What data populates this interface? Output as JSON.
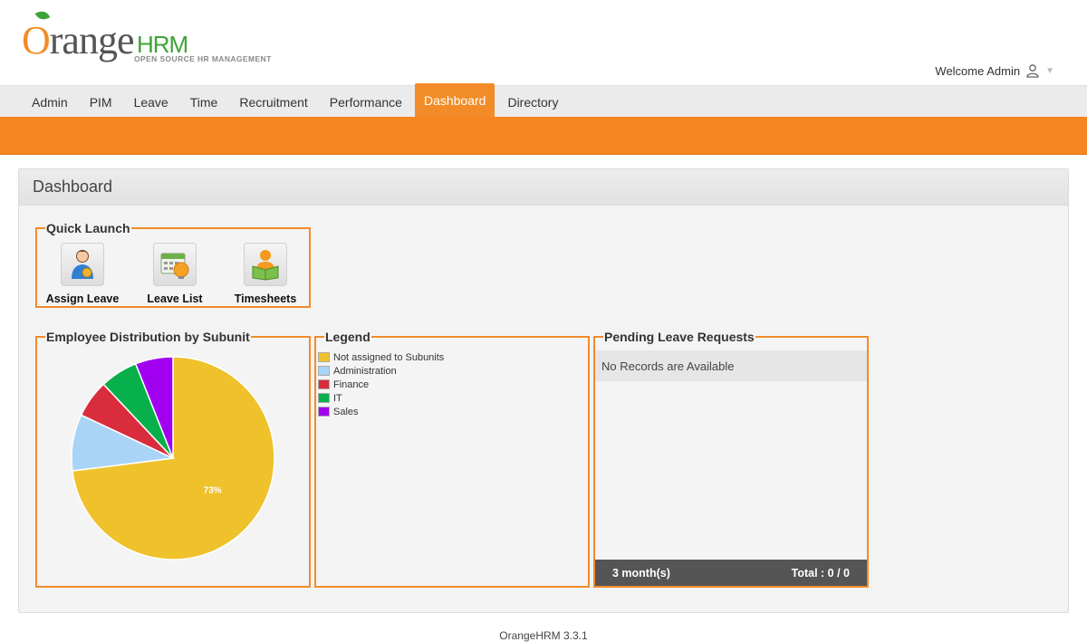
{
  "branding": {
    "logo_main": "range",
    "logo_o": "O",
    "logo_hrm": "HRM",
    "logo_tagline": "OPEN SOURCE HR MANAGEMENT",
    "welcome": "Welcome Admin"
  },
  "menu": {
    "items": [
      {
        "label": "Admin"
      },
      {
        "label": "PIM"
      },
      {
        "label": "Leave"
      },
      {
        "label": "Time"
      },
      {
        "label": "Recruitment"
      },
      {
        "label": "Performance"
      },
      {
        "label": "Dashboard",
        "active": true
      },
      {
        "label": "Directory"
      }
    ]
  },
  "dashboard": {
    "title": "Dashboard",
    "quick_launch": {
      "title": "Quick Launch",
      "items": [
        {
          "label": "Assign Leave",
          "icon": "assign-leave-icon"
        },
        {
          "label": "Leave List",
          "icon": "leave-list-icon"
        },
        {
          "label": "Timesheets",
          "icon": "timesheets-icon"
        }
      ]
    },
    "distribution": {
      "title": "Employee Distribution by Subunit"
    },
    "legend": {
      "title": "Legend",
      "items": [
        {
          "label": "Not assigned to Subunits",
          "color": "#efc22b"
        },
        {
          "label": "Administration",
          "color": "#aad4f5"
        },
        {
          "label": "Finance",
          "color": "#d92d3d"
        },
        {
          "label": "IT",
          "color": "#07b04a"
        },
        {
          "label": "Sales",
          "color": "#a000ef"
        }
      ]
    },
    "pending": {
      "title": "Pending Leave Requests",
      "empty_text": "No Records are Available",
      "period": "3 month(s)",
      "total": "Total : 0 / 0"
    }
  },
  "chart_data": {
    "type": "pie",
    "categories": [
      "Not assigned to Subunits",
      "Administration",
      "Finance",
      "IT",
      "Sales"
    ],
    "values": [
      73,
      9,
      6,
      6,
      6
    ],
    "colors": [
      "#efc22b",
      "#aad4f5",
      "#d92d3d",
      "#07b04a",
      "#a000ef"
    ],
    "data_labels": [
      "73%",
      "",
      "",
      "",
      ""
    ]
  },
  "footer": {
    "version": "OrangeHRM 3.3.1"
  }
}
